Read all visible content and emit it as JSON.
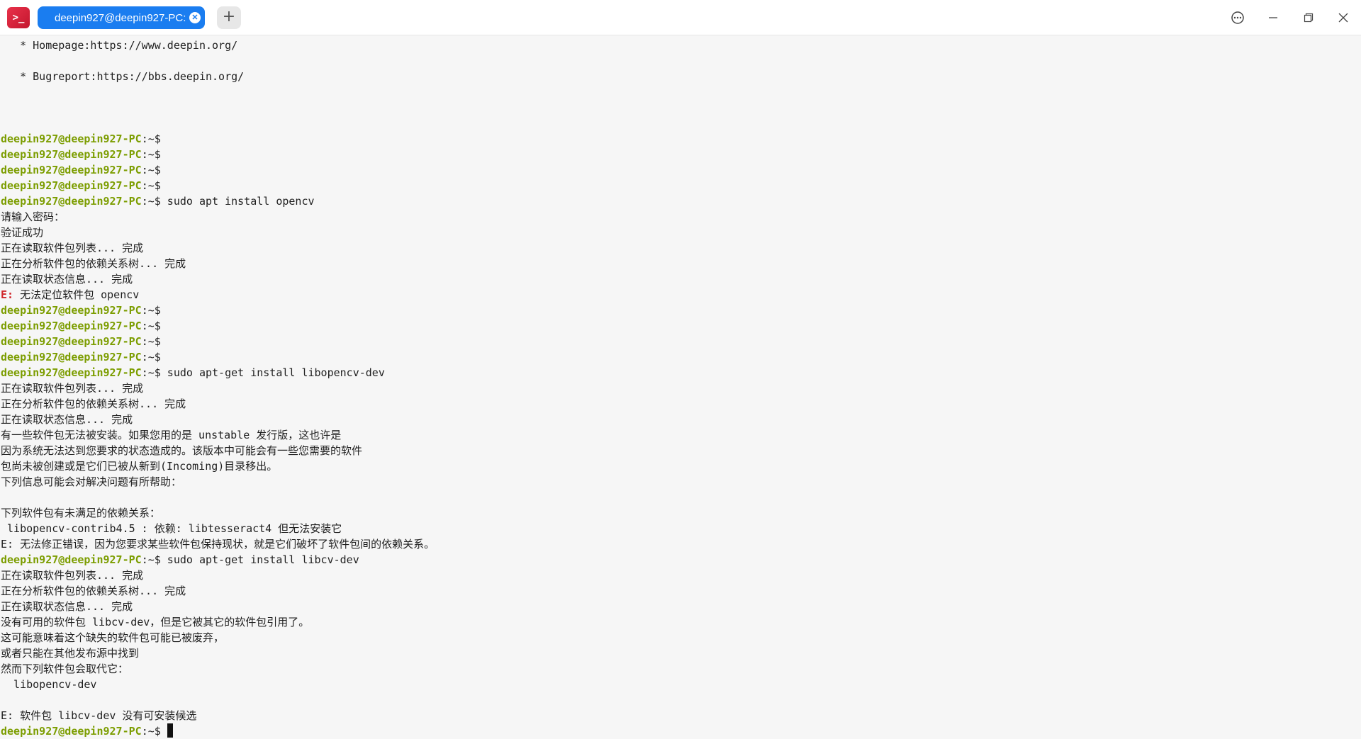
{
  "window": {
    "tab_title": "deepin927@deepin927-PC: ~",
    "new_tab_label": "+",
    "app_icon_text": ">_"
  },
  "terminal": {
    "prompt_user": "deepin927@deepin927-PC",
    "prompt_suffix": ":~$",
    "lines": [
      "   * Homepage:https://www.deepin.org/",
      "",
      "   * Bugreport:https://bbs.deepin.org/",
      "",
      "",
      "",
      "",
      "",
      "",
      "",
      " sudo apt install opencv",
      "请输入密码：",
      "验证成功",
      "正在读取软件包列表... 完成",
      "正在分析软件包的依赖关系树... 完成",
      "正在读取状态信息... 完成",
      " 无法定位软件包 opencv",
      "",
      "",
      "",
      "",
      " sudo apt-get install libopencv-dev",
      "正在读取软件包列表... 完成",
      "正在分析软件包的依赖关系树... 完成",
      "正在读取状态信息... 完成",
      "有一些软件包无法被安装。如果您用的是 unstable 发行版，这也许是",
      "因为系统无法达到您要求的状态造成的。该版本中可能会有一些您需要的软件",
      "包尚未被创建或是它们已被从新到(Incoming)目录移出。",
      "下列信息可能会对解决问题有所帮助：",
      "",
      "下列软件包有未满足的依赖关系：",
      " libopencv-contrib4.5 : 依赖: libtesseract4 但无法安装它",
      "E: 无法修正错误，因为您要求某些软件包保持现状，就是它们破坏了软件包间的依赖关系。",
      " sudo apt-get install libcv-dev",
      "正在读取软件包列表... 完成",
      "正在分析软件包的依赖关系树... 完成",
      "正在读取状态信息... 完成",
      "没有可用的软件包 libcv-dev，但是它被其它的软件包引用了。",
      "这可能意味着这个缺失的软件包可能已被废弃，",
      "或者只能在其他发布源中找到",
      "然而下列软件包会取代它：",
      "  libopencv-dev",
      "",
      "E: 软件包 libcv-dev 没有可安装候选",
      ""
    ],
    "line_kinds": [
      "text",
      "text",
      "text",
      "text",
      "text",
      "text",
      "prompt",
      "prompt",
      "prompt",
      "prompt",
      "prompt",
      "text",
      "text",
      "text",
      "text",
      "text",
      "error",
      "prompt",
      "prompt",
      "prompt",
      "prompt",
      "prompt",
      "text",
      "text",
      "text",
      "text",
      "text",
      "text",
      "text",
      "text",
      "text",
      "text",
      "text",
      "prompt",
      "text",
      "text",
      "text",
      "text",
      "text",
      "text",
      "text",
      "text",
      "text",
      "text",
      "prompt"
    ],
    "error_prefix": "E:",
    "colors": {
      "prompt": "#7c9d00",
      "error": "#d0262a",
      "text": "#1f1f1f",
      "background": "#f6f6f6",
      "tab_active": "#1a7df0"
    }
  }
}
